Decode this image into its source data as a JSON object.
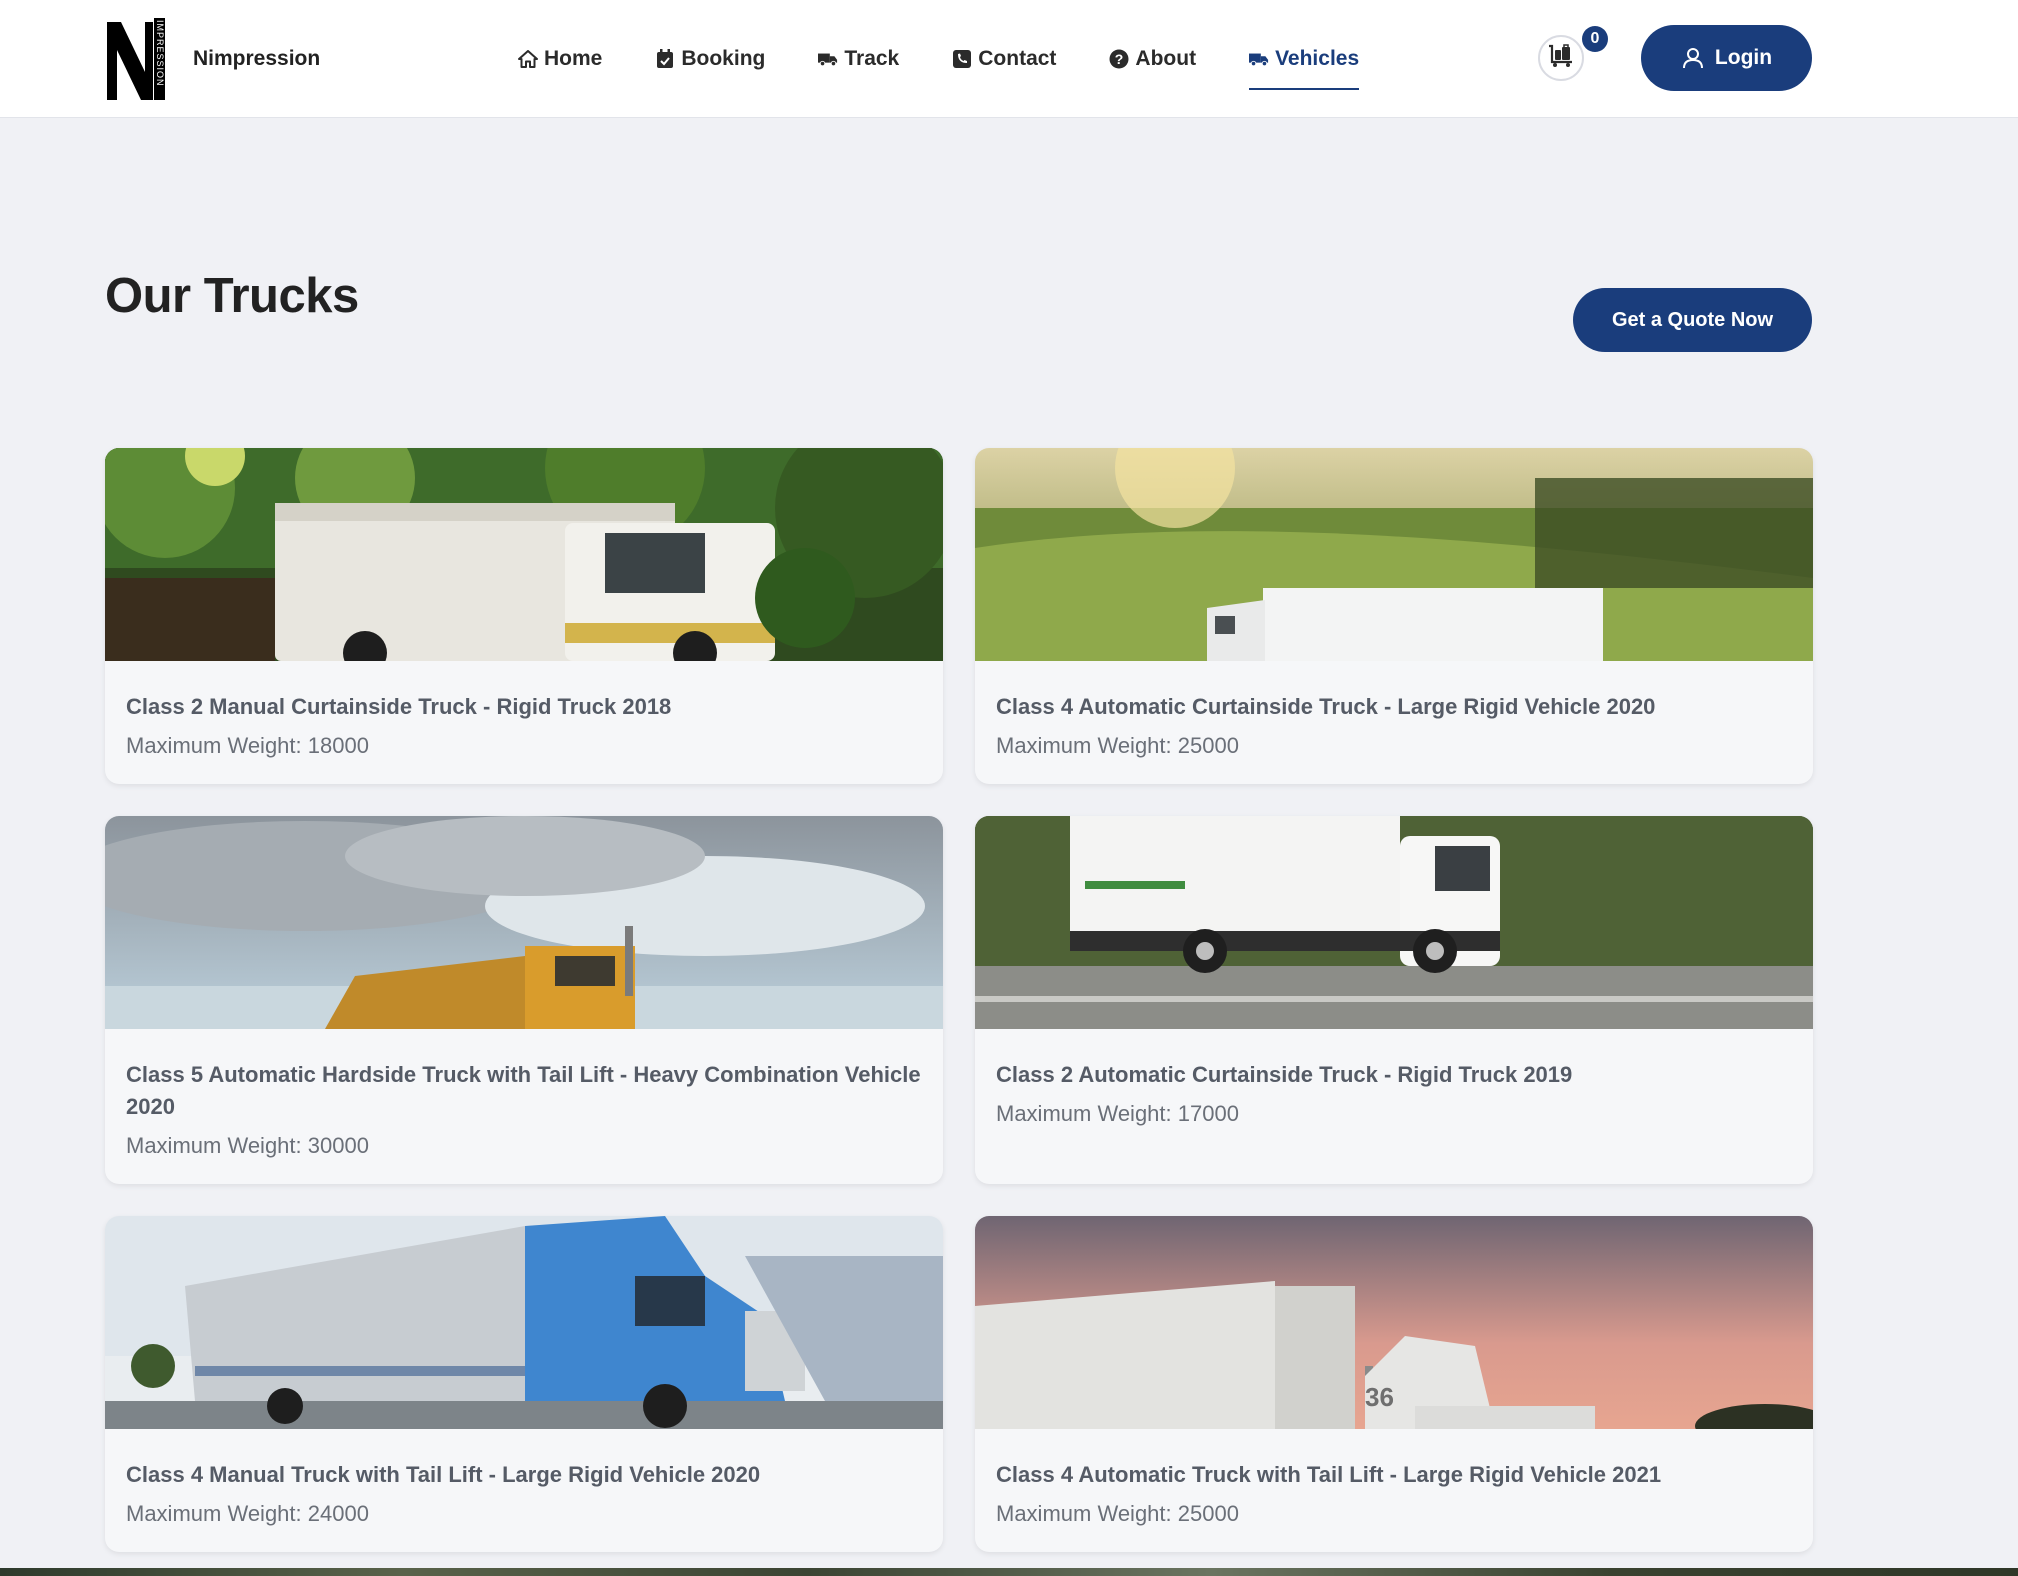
{
  "header": {
    "brand_name": "Nimpression",
    "logo_letter": "N",
    "logo_vertical_text": "IMPRESSION",
    "nav": [
      {
        "label": "Home",
        "icon": "home-icon",
        "active": false
      },
      {
        "label": "Booking",
        "icon": "calendar-check-icon",
        "active": false
      },
      {
        "label": "Track",
        "icon": "truck-icon",
        "active": false
      },
      {
        "label": "Contact",
        "icon": "phone-icon",
        "active": false
      },
      {
        "label": "About",
        "icon": "question-circle-icon",
        "active": false
      },
      {
        "label": "Vehicles",
        "icon": "truck-icon",
        "active": true
      }
    ],
    "cart_count": "0",
    "login_label": "Login"
  },
  "main": {
    "title": "Our Trucks",
    "quote_button": "Get a Quote Now",
    "trucks": [
      {
        "name": "Class 2 Manual Curtainside Truck - Rigid Truck 2018",
        "weight": "Maximum Weight: 18000"
      },
      {
        "name": "Class 4 Automatic Curtainside Truck - Large Rigid Vehicle 2020",
        "weight": "Maximum Weight: 25000"
      },
      {
        "name": "Class 5 Automatic Hardside Truck with Tail Lift - Heavy Combination Vehicle 2020",
        "weight": "Maximum Weight: 30000"
      },
      {
        "name": "Class 2 Automatic Curtainside Truck - Rigid Truck 2019",
        "weight": "Maximum Weight: 17000"
      },
      {
        "name": "Class 4 Manual Truck with Tail Lift - Large Rigid Vehicle 2020",
        "weight": "Maximum Weight: 24000"
      },
      {
        "name": "Class 4 Automatic Truck with Tail Lift - Large Rigid Vehicle 2021",
        "weight": "Maximum Weight: 25000",
        "plate_number": "36"
      }
    ]
  },
  "colors": {
    "primary": "#1a3d7c",
    "background": "#f0f1f5",
    "card": "#f6f7f9"
  }
}
